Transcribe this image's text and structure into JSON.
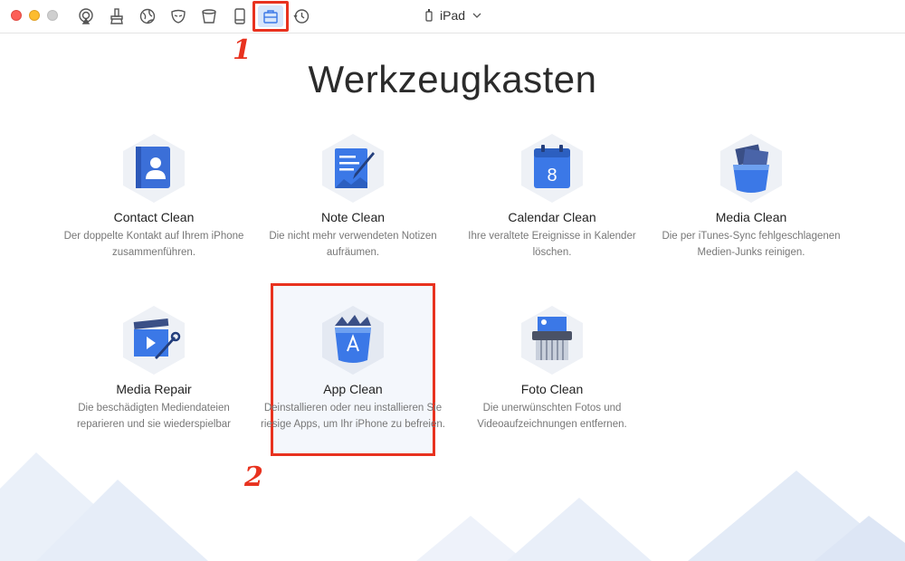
{
  "toolbar": {
    "device_name": "iPad",
    "tools": [
      "airplay-icon",
      "cleaner-icon",
      "globe-icon",
      "privacy-mask-icon",
      "trash-bin-icon",
      "phone-icon",
      "toolbox-icon",
      "history-icon"
    ],
    "active_tool": "toolbox-icon"
  },
  "annotations": {
    "step1": "1",
    "step2": "2"
  },
  "page": {
    "title": "Werkzeugkasten"
  },
  "cards": [
    {
      "title": "Contact Clean",
      "desc": "Der doppelte Kontakt auf Ihrem iPhone zusammenführen.",
      "icon": "contact-book-icon"
    },
    {
      "title": "Note Clean",
      "desc": "Die nicht mehr verwendeten Notizen aufräumen.",
      "icon": "note-pen-icon"
    },
    {
      "title": "Calendar Clean",
      "desc": "Ihre veraltete Ereignisse in Kalender löschen.",
      "icon": "calendar-icon",
      "icon_text": "8"
    },
    {
      "title": "Media Clean",
      "desc": "Die per iTunes-Sync fehlgeschlagenen Medien-Junks reinigen.",
      "icon": "media-bin-icon"
    },
    {
      "title": "Media Repair",
      "desc": "Die beschädigten Mediendateien reparieren und sie wiederspielbar",
      "icon": "clapper-wrench-icon"
    },
    {
      "title": "App Clean",
      "desc": "Deinstallieren oder neu installieren Sie riesige Apps, um Ihr iPhone zu befreien.",
      "icon": "app-bin-icon"
    },
    {
      "title": "Foto Clean",
      "desc": "Die unerwünschten Fotos und Videoaufzeichnungen entfernen.",
      "icon": "photo-shredder-icon"
    }
  ],
  "colors": {
    "accent": "#3b78e7",
    "annotation": "#e8321f",
    "hex_bg": "#eef1f6"
  }
}
